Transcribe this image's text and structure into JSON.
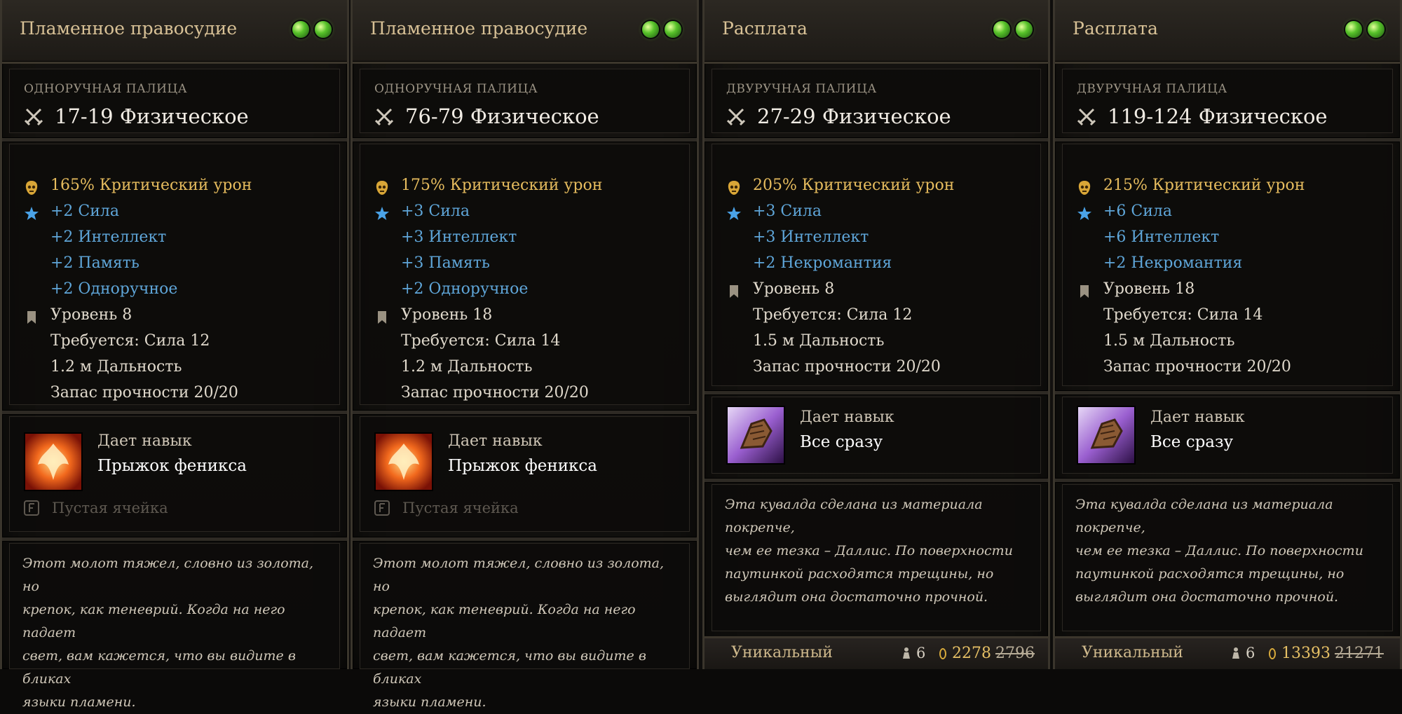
{
  "panels": [
    {
      "title": "Пламенное правосудие",
      "weapon_type": "ОДНОРУЧНАЯ ПАЛИЦА",
      "damage": "17-19 Физическое",
      "stats": [
        {
          "icon": "critical-damage-icon",
          "text": "165%  Критический урон",
          "color": "gold"
        },
        {
          "icon": "star-icon",
          "text": "+2 Сила",
          "color": "blue"
        },
        {
          "icon": "",
          "text": "+2 Интеллект",
          "color": "blue"
        },
        {
          "icon": "",
          "text": "+2 Память",
          "color": "blue"
        },
        {
          "icon": "",
          "text": "+2 Одноручное",
          "color": "blue"
        },
        {
          "icon": "level-bookmark-icon",
          "text": "Уровень 8",
          "color": "white"
        },
        {
          "icon": "",
          "text": "Требуется: Сила 12",
          "color": "white"
        },
        {
          "icon": "",
          "text": "1.2 м  Дальность",
          "color": "white"
        },
        {
          "icon": "",
          "text": "Запас прочности  20/20",
          "color": "white"
        }
      ],
      "skill_label": "Дает навык",
      "skill_name": "Прыжок феникса",
      "skill_icon": "phoenix-dive-icon",
      "empty_slot": "Пустая ячейка",
      "flavor": "Этот молот тяжел, словно из золота, но\nкрепок, как теневрий. Когда на него падает\nсвет, вам кажется, что вы видите в бликах\nязыки пламени."
    },
    {
      "title": "Пламенное правосудие",
      "weapon_type": "ОДНОРУЧНАЯ ПАЛИЦА",
      "damage": "76-79 Физическое",
      "stats": [
        {
          "icon": "critical-damage-icon",
          "text": "175%  Критический урон",
          "color": "gold"
        },
        {
          "icon": "star-icon",
          "text": "+3 Сила",
          "color": "blue"
        },
        {
          "icon": "",
          "text": "+3 Интеллект",
          "color": "blue"
        },
        {
          "icon": "",
          "text": "+3 Память",
          "color": "blue"
        },
        {
          "icon": "",
          "text": "+2 Одноручное",
          "color": "blue"
        },
        {
          "icon": "level-bookmark-icon",
          "text": "Уровень 18",
          "color": "white"
        },
        {
          "icon": "",
          "text": "Требуется: Сила 14",
          "color": "white"
        },
        {
          "icon": "",
          "text": "1.2 м  Дальность",
          "color": "white"
        },
        {
          "icon": "",
          "text": "Запас прочности  20/20",
          "color": "white"
        }
      ],
      "skill_label": "Дает навык",
      "skill_name": "Прыжок феникса",
      "skill_icon": "phoenix-dive-icon",
      "empty_slot": "Пустая ячейка",
      "flavor": "Этот молот тяжел, словно из золота, но\nкрепок, как теневрий. Когда на него падает\nсвет, вам кажется, что вы видите в бликах\nязыки пламени."
    },
    {
      "title": "Расплата",
      "weapon_type": "ДВУРУЧНАЯ ПАЛИЦА",
      "damage": "27-29 Физическое",
      "stats": [
        {
          "icon": "critical-damage-icon",
          "text": "205%  Критический урон",
          "color": "gold"
        },
        {
          "icon": "star-icon",
          "text": "+3 Сила",
          "color": "blue"
        },
        {
          "icon": "",
          "text": "+3 Интеллект",
          "color": "blue"
        },
        {
          "icon": "",
          "text": "+2 Некромантия",
          "color": "blue"
        },
        {
          "icon": "level-bookmark-icon",
          "text": "Уровень 8",
          "color": "white"
        },
        {
          "icon": "",
          "text": "Требуется: Сила 12",
          "color": "white"
        },
        {
          "icon": "",
          "text": "1.5 м  Дальность",
          "color": "white"
        },
        {
          "icon": "",
          "text": "Запас прочности  20/20",
          "color": "white"
        }
      ],
      "skill_label": "Дает навык",
      "skill_name": "Все сразу",
      "skill_icon": "all-in-fist-icon",
      "flavor": "Эта кувалда сделана из материала покрепче,\nчем ее тезка – Даллис. По поверхности\nпаутинкой расходятся трещины, но\nвыглядит она достаточно прочной.",
      "rarity": "Уникальный",
      "weight": "6",
      "price": "2278",
      "old_price": "2796"
    },
    {
      "title": "Расплата",
      "weapon_type": "ДВУРУЧНАЯ ПАЛИЦА",
      "damage": "119-124 Физическое",
      "stats": [
        {
          "icon": "critical-damage-icon",
          "text": "215%  Критический урон",
          "color": "gold"
        },
        {
          "icon": "star-icon",
          "text": "+6 Сила",
          "color": "blue"
        },
        {
          "icon": "",
          "text": "+6 Интеллект",
          "color": "blue"
        },
        {
          "icon": "",
          "text": "+2 Некромантия",
          "color": "blue"
        },
        {
          "icon": "level-bookmark-icon",
          "text": "Уровень 18",
          "color": "white"
        },
        {
          "icon": "",
          "text": "Требуется: Сила 14",
          "color": "white"
        },
        {
          "icon": "",
          "text": "1.5 м  Дальность",
          "color": "white"
        },
        {
          "icon": "",
          "text": "Запас прочности  20/20",
          "color": "white"
        }
      ],
      "skill_label": "Дает навык",
      "skill_name": "Все сразу",
      "skill_icon": "all-in-fist-icon",
      "flavor": "Эта кувалда сделана из материала покрепче,\nчем ее тезка – Даллис. По поверхности\nпаутинкой расходятся трещины, но\nвыглядит она достаточно прочной.",
      "rarity": "Уникальный",
      "weight": "6",
      "price": "13393",
      "old_price": "21271"
    }
  ],
  "colors": {
    "gold": "#e6bc5e",
    "blue": "#5fa6d9",
    "white": "#e0d9cc",
    "title": "#d8c196"
  }
}
